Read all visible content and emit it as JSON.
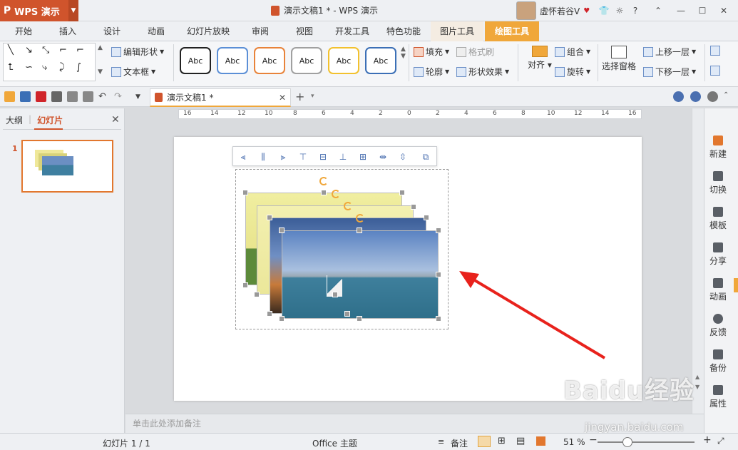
{
  "app": {
    "name": "WPS 演示",
    "window_title": "演示文稿1 * - WPS 演示",
    "user": "虚怀若谷V"
  },
  "tabs": [
    {
      "label": "开始"
    },
    {
      "label": "插入"
    },
    {
      "label": "设计"
    },
    {
      "label": "动画"
    },
    {
      "label": "幻灯片放映"
    },
    {
      "label": "审阅"
    },
    {
      "label": "视图"
    },
    {
      "label": "开发工具"
    },
    {
      "label": "特色功能"
    },
    {
      "label": "图片工具"
    },
    {
      "label": "绘图工具"
    }
  ],
  "active_tab": "绘图工具",
  "ribbon": {
    "edit_shape": "编辑形状",
    "text_box": "文本框",
    "style_sample": "Abc",
    "style_colors": [
      "#222222",
      "#5b8fd6",
      "#e8833a",
      "#a0a0a0",
      "#f2c12e",
      "#3b6fb6"
    ],
    "fill": "填充",
    "format_painter": "格式刷",
    "outline": "轮廓",
    "shape_effects": "形状效果",
    "align": "对齐",
    "group": "组合",
    "rotate": "旋转",
    "selection_pane": "选择窗格",
    "bring_forward": "上移一层",
    "send_backward": "下移一层"
  },
  "document_tab": {
    "label": "演示文稿1 *"
  },
  "left_panel": {
    "tab_outline": "大纲",
    "tab_slides": "幻灯片",
    "slide_number": "1"
  },
  "notes_placeholder": "单击此处添加备注",
  "right_sidebar": [
    {
      "label": "新建"
    },
    {
      "label": "切换"
    },
    {
      "label": "模板"
    },
    {
      "label": "分享"
    },
    {
      "label": "动画"
    },
    {
      "label": "反馈"
    },
    {
      "label": "备份"
    },
    {
      "label": "属性"
    }
  ],
  "status": {
    "slide_info": "幻灯片 1 / 1",
    "theme": "Office 主题",
    "notes": "备注",
    "zoom": "51 %"
  },
  "ruler_labels": [
    "16",
    "14",
    "12",
    "10",
    "8",
    "6",
    "4",
    "2",
    "0",
    "2",
    "4",
    "6",
    "8",
    "10",
    "12",
    "14",
    "16"
  ],
  "watermark": {
    "main": "Baidu经验",
    "sub": "jingyan.baidu.com"
  },
  "accent_color": "#f0a73a",
  "brand_color": "#d0542c"
}
